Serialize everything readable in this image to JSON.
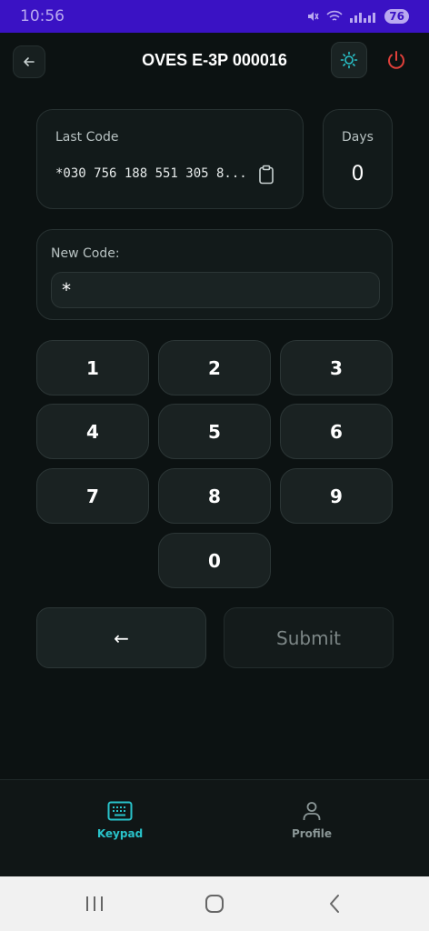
{
  "status_bar": {
    "time": "10:56",
    "battery": "76"
  },
  "app_bar": {
    "title": "OVES E-3P 000016"
  },
  "last_code": {
    "label": "Last Code",
    "value": "*030 756 188 551 305 8..."
  },
  "days": {
    "label": "Days",
    "value": "0"
  },
  "new_code": {
    "label": "New Code:",
    "value": "*"
  },
  "keypad": {
    "keys": [
      "1",
      "2",
      "3",
      "4",
      "5",
      "6",
      "7",
      "8",
      "9",
      "0"
    ]
  },
  "actions": {
    "backspace_label": "←",
    "submit_label": "Submit"
  },
  "bottom_nav": {
    "items": [
      {
        "label": "Keypad",
        "icon": "keyboard-icon",
        "active": true
      },
      {
        "label": "Profile",
        "icon": "person-icon",
        "active": false
      }
    ]
  },
  "colors": {
    "accent": "#29c2c9",
    "power": "#e0403a",
    "status_bar": "#3a12c4",
    "background": "#0c1212"
  }
}
